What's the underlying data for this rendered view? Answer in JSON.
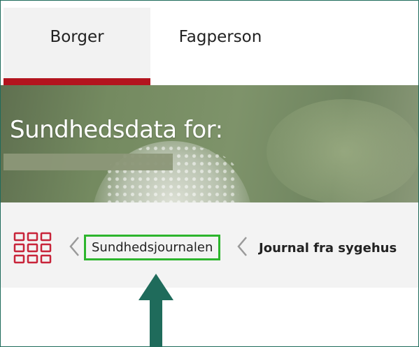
{
  "tabs": [
    {
      "label": "Borger",
      "active": true
    },
    {
      "label": "Fagperson",
      "active": false
    }
  ],
  "hero": {
    "title": "Sundhedsdata for:"
  },
  "breadcrumb": {
    "menu_icon": "grid-menu-icon",
    "items": [
      {
        "label": "Sundhedsjournalen",
        "highlighted": true
      },
      {
        "label": "Journal fra sygehus",
        "current": true
      }
    ]
  },
  "colors": {
    "active_tab_underline": "#b3141e",
    "grid_icon": "#c8243a",
    "highlight_border": "#2db52d",
    "annotation_arrow": "#1f6b5b",
    "frame": "#1f6b5b"
  }
}
